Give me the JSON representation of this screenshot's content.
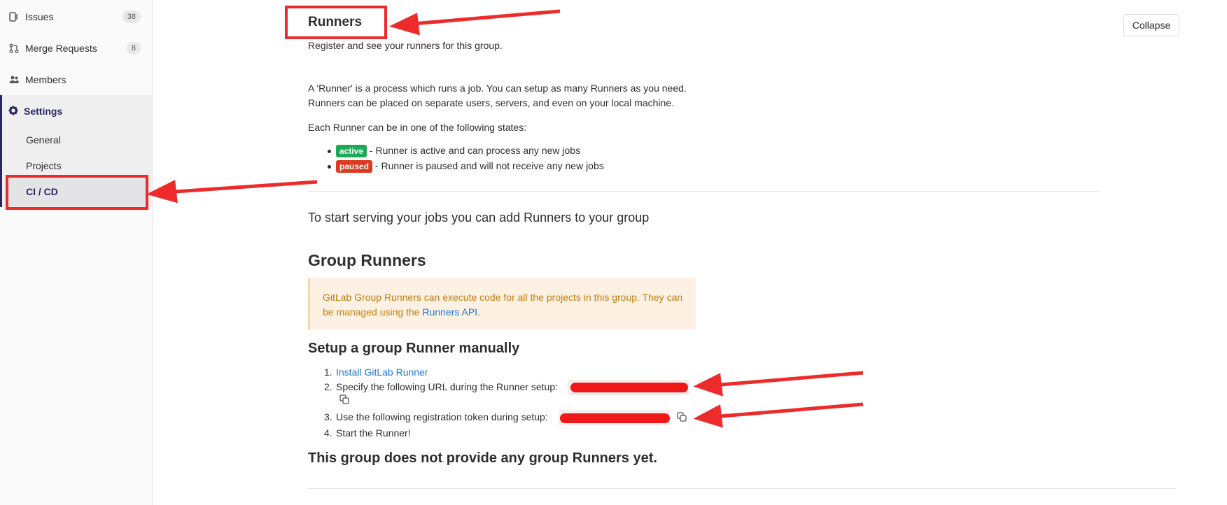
{
  "sidebar": {
    "issues": {
      "label": "Issues",
      "count": "38"
    },
    "merge_requests": {
      "label": "Merge Requests",
      "count": "8"
    },
    "members": {
      "label": "Members"
    },
    "settings": {
      "label": "Settings"
    },
    "sub_items": {
      "general": "General",
      "projects": "Projects",
      "cicd": "CI / CD"
    }
  },
  "runners": {
    "title": "Runners",
    "subtitle": "Register and see your runners for this group.",
    "collapse_label": "Collapse",
    "intro_line1": "A 'Runner' is a process which runs a job. You can setup as many Runners as you need.",
    "intro_line2": "Runners can be placed on separate users, servers, and even on your local machine.",
    "states_intro": "Each Runner can be in one of the following states:",
    "states": [
      {
        "badge": "active",
        "text": "- Runner is active and can process any new jobs"
      },
      {
        "badge": "paused",
        "text": "- Runner is paused and will not receive any new jobs"
      }
    ],
    "start_serving": "To start serving your jobs you can add Runners to your group"
  },
  "group_runners": {
    "heading": "Group Runners",
    "warning_text": "GitLab Group Runners can execute code for all the projects in this group. They can be managed using the ",
    "warning_link": "Runners API",
    "warning_end": "."
  },
  "setup": {
    "heading": "Setup a group Runner manually",
    "steps": [
      {
        "num": "1.",
        "link": "Install GitLab Runner"
      },
      {
        "num": "2.",
        "text": "Specify the following URL during the Runner setup:"
      },
      {
        "num": "3.",
        "text": "Use the following registration token during setup:"
      },
      {
        "num": "4.",
        "text": "Start the Runner!"
      }
    ],
    "empty_message": "This group does not provide any group Runners yet."
  },
  "colors": {
    "annotation_red": "#ee2b2b",
    "sidebar_active": "#292961",
    "active_badge": "#1aaa55",
    "paused_badge": "#db3b21",
    "warning_bg": "#fdf1e3",
    "link": "#1f78d1"
  },
  "icons": [
    "issues-icon",
    "merge-request-icon",
    "members-icon",
    "settings-gear-icon",
    "copy-icon"
  ]
}
